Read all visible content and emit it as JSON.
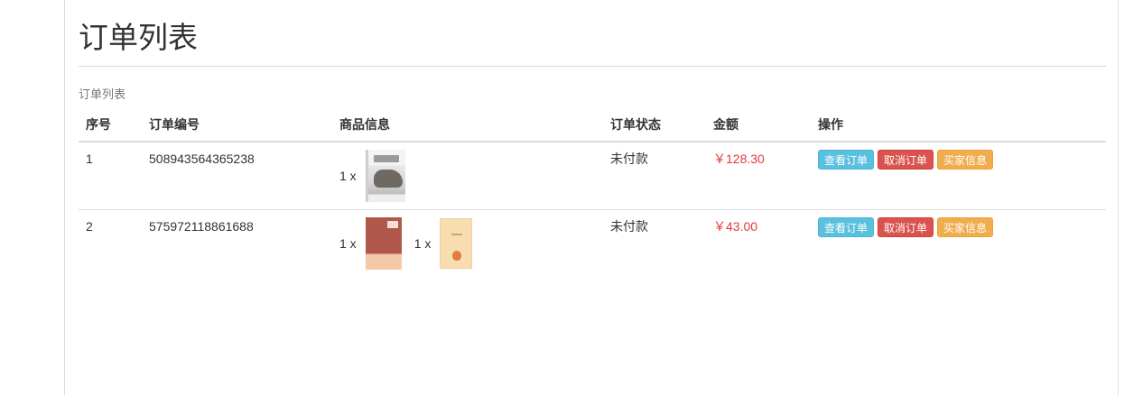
{
  "page": {
    "title": "订单列表",
    "caption": "订单列表"
  },
  "table": {
    "headers": [
      "序号",
      "订单编号",
      "商品信息",
      "订单状态",
      "金额",
      "操作"
    ],
    "rows": [
      {
        "index": "1",
        "order_no": "508943564365238",
        "items": [
          {
            "qty": "1 x",
            "cover_icon": "javascript-book-cover"
          }
        ],
        "status": "未付款",
        "amount": "￥128.30",
        "actions": {
          "view": "查看订单",
          "cancel": "取消订单",
          "buyer": "买家信息"
        }
      },
      {
        "index": "2",
        "order_no": "575972118861688",
        "items": [
          {
            "qty": "1 x",
            "cover_icon": "red-book-cover"
          },
          {
            "qty": "1 x",
            "cover_icon": "yellow-book-cover"
          }
        ],
        "status": "未付款",
        "amount": "￥43.00",
        "actions": {
          "view": "查看订单",
          "cancel": "取消订单",
          "buyer": "买家信息"
        }
      }
    ]
  },
  "colors": {
    "price": "#e4393c",
    "view_button": "#5bc0de",
    "cancel_button": "#d9534f",
    "buyer_button": "#f0ad4e"
  }
}
